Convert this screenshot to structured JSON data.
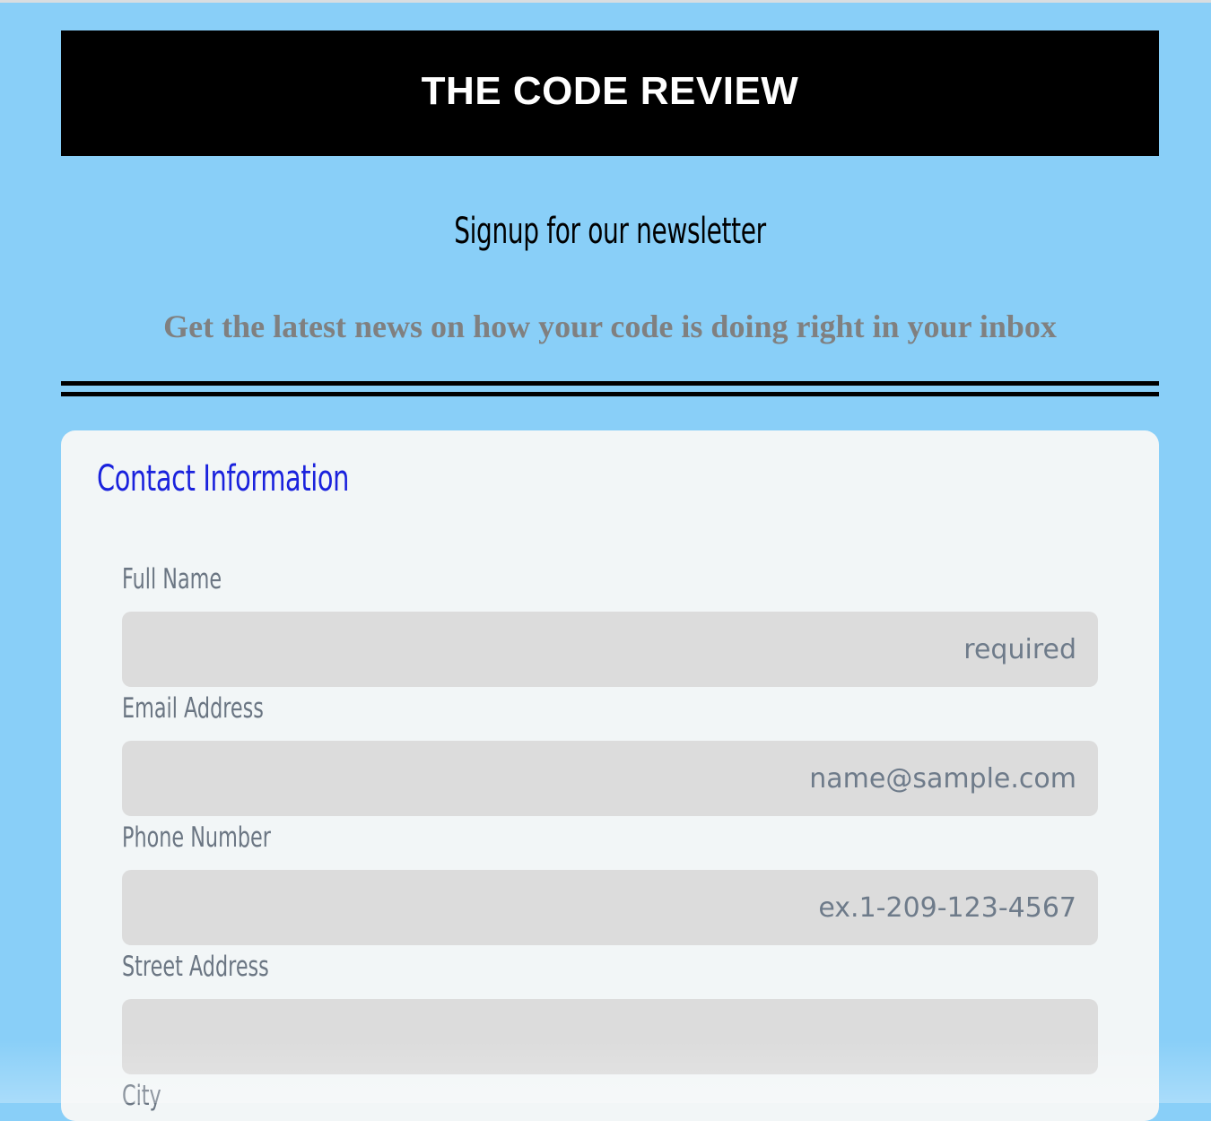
{
  "header": {
    "site_title": "THE CODE REVIEW"
  },
  "intro": {
    "headline": "Signup for our newsletter",
    "tagline": "Get the latest news on how your code is doing right in your inbox"
  },
  "form": {
    "section_title": "Contact Information",
    "fields": [
      {
        "label": "Full Name",
        "placeholder": "required",
        "value": ""
      },
      {
        "label": "Email Address",
        "placeholder": "name@sample.com",
        "value": ""
      },
      {
        "label": "Phone Number",
        "placeholder": "ex.1-209-123-4567",
        "value": ""
      },
      {
        "label": "Street Address",
        "placeholder": "",
        "value": ""
      },
      {
        "label": "City"
      }
    ]
  },
  "colors": {
    "page_background": "#89cff8",
    "header_background": "#000000",
    "section_title": "#1a22dd",
    "tagline": "#808080",
    "field_label": "#6b7683",
    "input_background": "#dcdcdc"
  }
}
